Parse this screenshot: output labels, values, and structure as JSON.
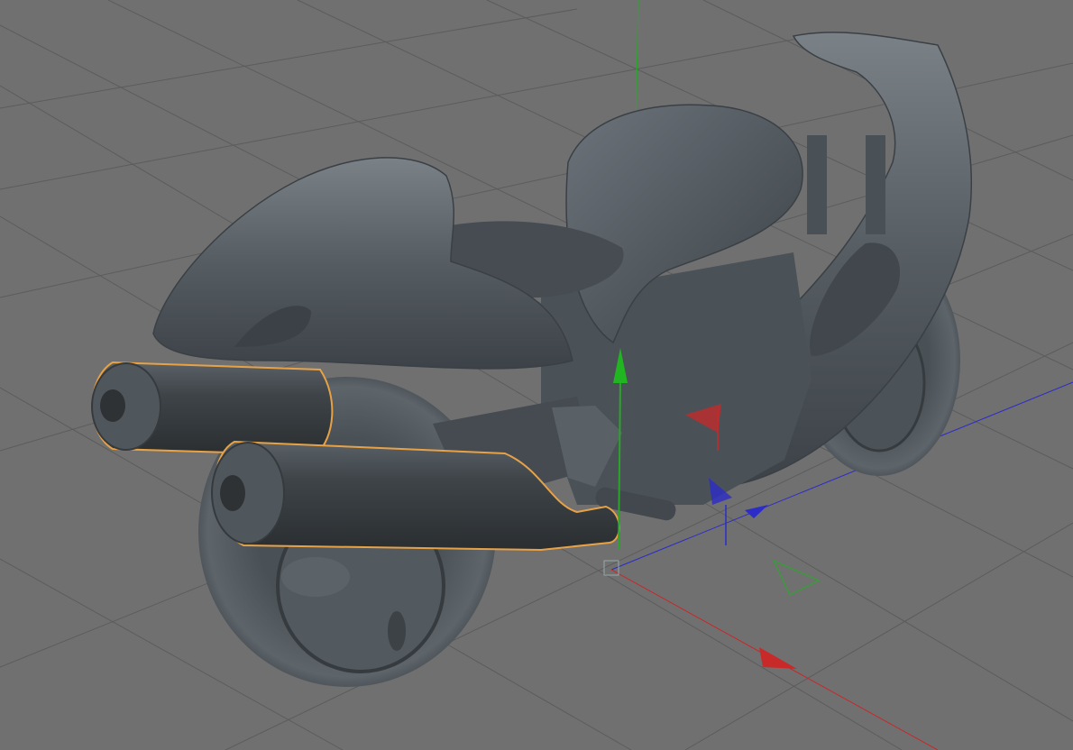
{
  "viewport": {
    "background": "#707070",
    "grid_color": "#5c5c5c",
    "model_color": "#4c5358",
    "selection_color": "#e8a246",
    "x_axis_color": "#c8282a",
    "y_axis_color": "#2aa52a",
    "z_axis_color": "#2c2cc8",
    "objects": [
      "motorcycle-body",
      "exhaust-muffler-left",
      "exhaust-muffler-right"
    ],
    "selected_object": "exhaust-muffler-right",
    "icons": [
      "move-x-handle-icon",
      "move-y-handle-icon",
      "move-z-handle-icon",
      "world-origin-icon"
    ]
  }
}
